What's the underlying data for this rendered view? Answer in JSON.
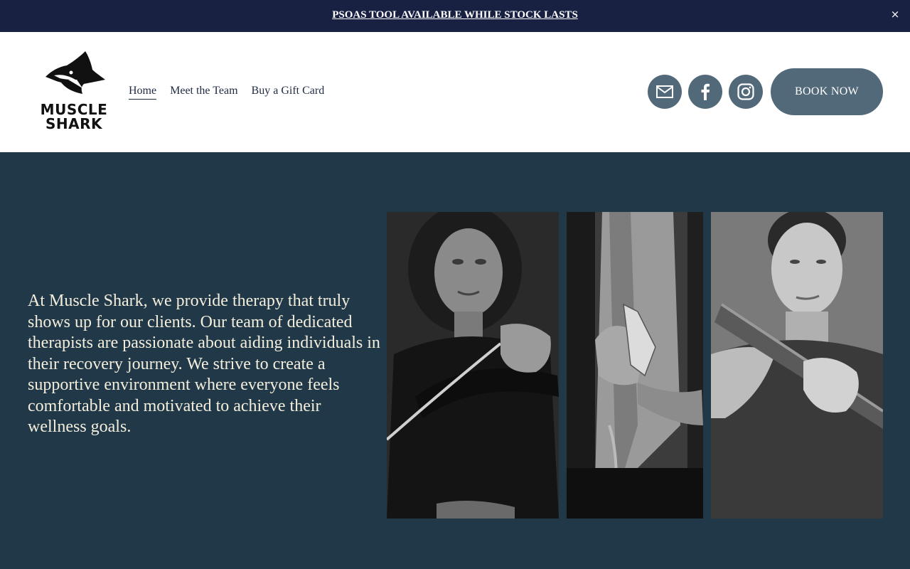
{
  "announcement": {
    "text": "PSOAS TOOL AVAILABLE WHILE STOCK LASTS",
    "close": "×"
  },
  "logo": {
    "line1": "MUSCLE",
    "line2": "SHARK",
    "icon": "shark-icon"
  },
  "nav": {
    "items": [
      {
        "label": "Home",
        "active": true
      },
      {
        "label": "Meet the Team",
        "active": false
      },
      {
        "label": "Buy a Gift Card",
        "active": false
      }
    ]
  },
  "social": {
    "icons": [
      "email-icon",
      "facebook-icon",
      "instagram-icon"
    ]
  },
  "cta": {
    "label": "BOOK NOW"
  },
  "hero": {
    "text": "At Muscle Shark, we provide therapy that truly shows up for our clients. Our team of dedicated therapists are passionate about aiding individuals in their recovery journey. We strive to create a supportive environment where everyone feels comfortable and motivated to achieve their wellness goals."
  },
  "colors": {
    "announcement_bg": "#192143",
    "page_bg": "#213849",
    "button_bg": "#52697a",
    "hero_text": "#f4efdc",
    "nav_text": "#1f2a44"
  }
}
